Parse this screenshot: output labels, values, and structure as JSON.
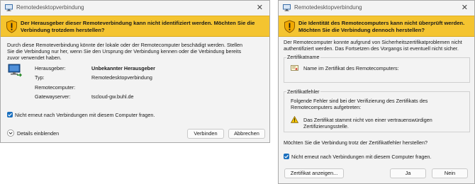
{
  "dialog_left": {
    "title": "Remotedesktopverbindung",
    "close_glyph": "✕",
    "banner_line1": "Der Herausgeber dieser Remoteverbindung kann nicht identifiziert werden. Möchten Sie die",
    "banner_line2": "Verbindung trotzdem herstellen?",
    "body_line1": "Durch diese Remoteverbindung könnte der lokale oder der Remotecomputer beschädigt werden. Stellen",
    "body_line2": "Sie die Verbindung nur her, wenn Sie den Ursprung der Verbindung kennen oder die Verbindung bereits",
    "body_line3": "zuvor verwendet haben.",
    "details": [
      {
        "label": "Herausgeber:",
        "value": "Unbekannter Herausgeber"
      },
      {
        "label": "Typ:",
        "value": "Remotedesktopverbindung"
      },
      {
        "label": "Remotecomputer:",
        "value": ""
      },
      {
        "label": "Gatewayserver:",
        "value": "tscloud-gw.buhl.de"
      }
    ],
    "checkbox_label": "Nicht erneut nach Verbindungen mit diesem Computer fragen.",
    "details_toggle": "Details einblenden",
    "connect_button": "Verbinden",
    "cancel_button": "Abbrechen"
  },
  "dialog_right": {
    "title": "Remotedesktopverbindung",
    "close_glyph": "✕",
    "banner_line1": "Die Identität des Remotecomputers kann nicht überprüft werden.",
    "banner_line2": "Möchten Sie die Verbindung dennoch herstellen?",
    "body_line1": "Der Remotecomputer konnte aufgrund von Sicherheitszertifikatproblemen nicht",
    "body_line2": "authentifiziert werden. Das Fortsetzen des Vorgangs ist eventuell nicht sicher.",
    "cert_name_group": "Zertifikatname",
    "cert_name_text": "Name im Zertifikat des Remotecomputers:",
    "cert_error_group": "Zertifikatfehler",
    "cert_error_line1": "Folgende Fehler sind bei der Verifizierung des Zertifikats des",
    "cert_error_line2": "Remotecomputers aufgetreten:",
    "cert_error_item_line1": "Das Zertifikat stammt nicht von einer vertrauenswürdigen",
    "cert_error_item_line2": "Zertifizierungsstelle.",
    "question": "Möchten Sie die Verbindung trotz der Zertifikatfehler herstellen?",
    "checkbox_label": "Nicht erneut nach Verbindungen mit diesem Computer fragen.",
    "show_cert_button": "Zertifikat anzeigen...",
    "yes_button": "Ja",
    "no_button": "Nein"
  },
  "colors": {
    "banner": "#f4c430",
    "accent": "#1a6fbe",
    "dialog_bg": "#f3f3f3"
  }
}
